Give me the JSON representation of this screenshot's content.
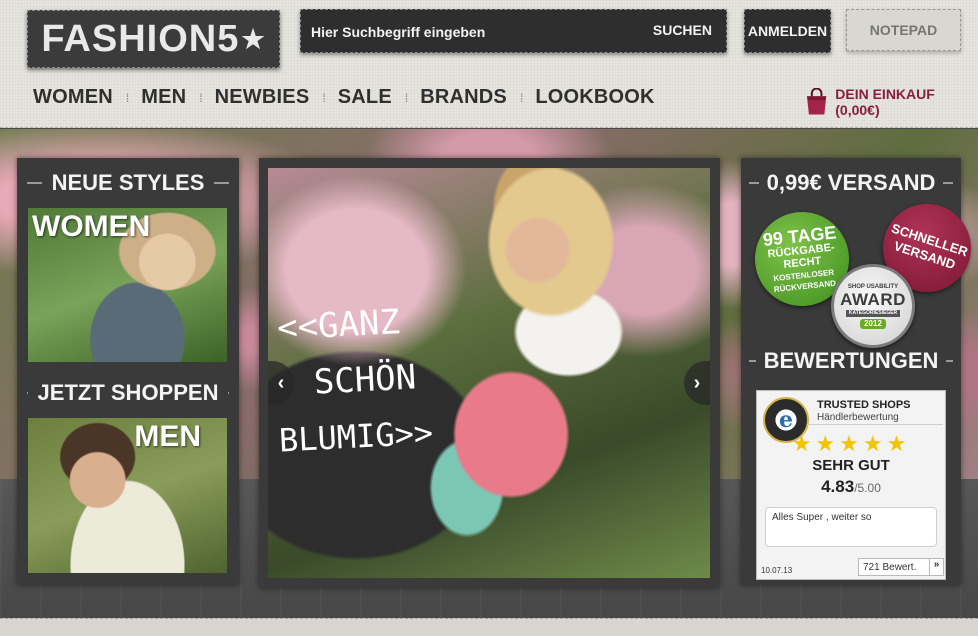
{
  "header": {
    "logo_text": "FASHION5",
    "logo_star": "★",
    "search": {
      "placeholder": "Hier Suchbegriff eingeben",
      "button_label": "SUCHEN"
    },
    "login_label": "ANMELDEN",
    "notepad_label": "NOTEPAD",
    "nav": [
      {
        "label": "WOMEN"
      },
      {
        "label": "MEN"
      },
      {
        "label": "NEWBIES"
      },
      {
        "label": "SALE"
      },
      {
        "label": "BRANDS"
      },
      {
        "label": "LOOKBOOK"
      }
    ],
    "nav_separator": "⁞",
    "cart_label": "DEIN EINKAUF (0,00€)",
    "cart_color": "#8a1d3f"
  },
  "left_panel": {
    "heading_top": "NEUE STYLES",
    "tile_women_label": "WOMEN",
    "heading_bottom": "JETZT SHOPPEN",
    "tile_men_label": "MEN"
  },
  "hero": {
    "text_lines": [
      "<<GANZ",
      "SCHÖN",
      "BLUMIG>>"
    ],
    "prev_arrow": "‹",
    "next_arrow": "›"
  },
  "right_panel": {
    "heading_top": "0,99€ VERSAND",
    "badge_green": {
      "line1": "99 TAGE",
      "line2": "RÜCKGABE-",
      "line3": "RECHT",
      "line4": "KOSTENLOSER",
      "line5": "RÜCKVERSAND",
      "color": "#4f9e2b"
    },
    "badge_red": {
      "line1": "SCHNELLER",
      "line2": "VERSAND",
      "color": "#9a2446"
    },
    "badge_award": {
      "top": "SHOP USABILITY",
      "main": "AWARD",
      "ribbon": "KATEGORIESIEGER",
      "year": "2012"
    },
    "heading_bottom": "BEWERTUNGEN",
    "trusted_shops": {
      "seal_letter": "e",
      "title": "TRUSTED SHOPS",
      "subtitle": "Händlerbewertung",
      "stars": "★★★★★",
      "rating_text": "SEHR GUT",
      "score": "4.83",
      "score_max": "/5.00",
      "review_text": "Alles Super , weiter so",
      "review_date": "10.07.13",
      "review_count": "721 Bewert.",
      "go_arrow": "»"
    }
  }
}
